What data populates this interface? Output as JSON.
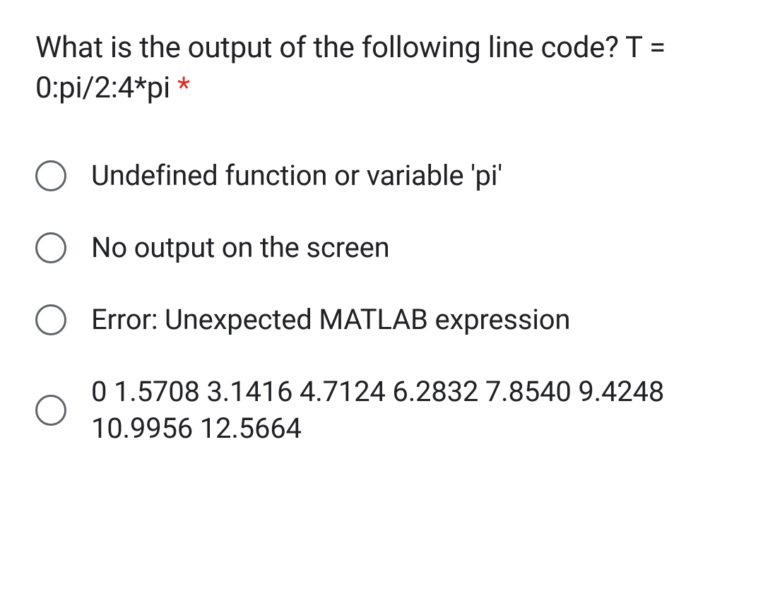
{
  "question": {
    "text": "What is the output of the following line code? T = 0:pi/2:4*pi",
    "required_marker": "*"
  },
  "options": [
    {
      "label": "Undefined function or variable 'pi'"
    },
    {
      "label": "No output on the screen"
    },
    {
      "label": "Error: Unexpected MATLAB expression"
    },
    {
      "label": "0 1.5708 3.1416 4.7124 6.2832 7.8540 9.4248 10.9956 12.5664"
    }
  ]
}
